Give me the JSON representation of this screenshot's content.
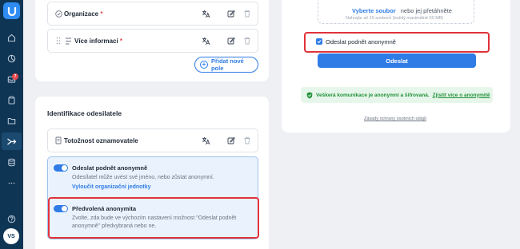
{
  "sidebar": {
    "avatar": "VS",
    "notification_count": "7",
    "items": [
      "home-icon",
      "dashboard-icon",
      "inbox-icon",
      "clipboard-icon",
      "folder-icon",
      "share-icon",
      "database-icon",
      "more-icon"
    ],
    "help_icon": "help-icon"
  },
  "form_fields": {
    "fields": [
      {
        "label": "Organizace",
        "required_mark": "*"
      },
      {
        "label": "Více informací",
        "required_mark": "*"
      }
    ],
    "add_field_label": "Přidat nové pole"
  },
  "identification": {
    "title": "Identifikace odesilatele",
    "field": {
      "label": "Totožnost oznamovatele"
    },
    "anonymous_submit": {
      "title": "Odeslat podnět anonymně",
      "description": "Odesílatel může uvést své jméno, nebo zůstat anonymní.",
      "link": "Vyloučit organizační jednotky"
    },
    "preset_anonymity": {
      "title": "Předvolená anonymita",
      "description": "Zvolte, zda bude ve výchozím nastavení možnost \"Odeslat podnět anonymně\" předvybraná nebo ne."
    }
  },
  "preview": {
    "upload_pick": "Vyberte soubor",
    "upload_drag": "nebo jej přetáhněte",
    "upload_limit": "Nahrajte až 20 souborů (každý maximálně 50 MB)",
    "anonymous_checkbox": "Odeslat podnět anonymně",
    "anonymous_checked": true,
    "submit_label": "Odeslat",
    "secure_text": "Veškerá komunikace je anonymní a šifrovaná.",
    "secure_link": "Zjistit více o anonymitě",
    "privacy_link": "Zásady ochrany osobních údajů"
  },
  "colors": {
    "sidebar": "#0f3554",
    "accent": "#2f7ce6",
    "highlight": "#e0323a",
    "success": "#21913a"
  }
}
